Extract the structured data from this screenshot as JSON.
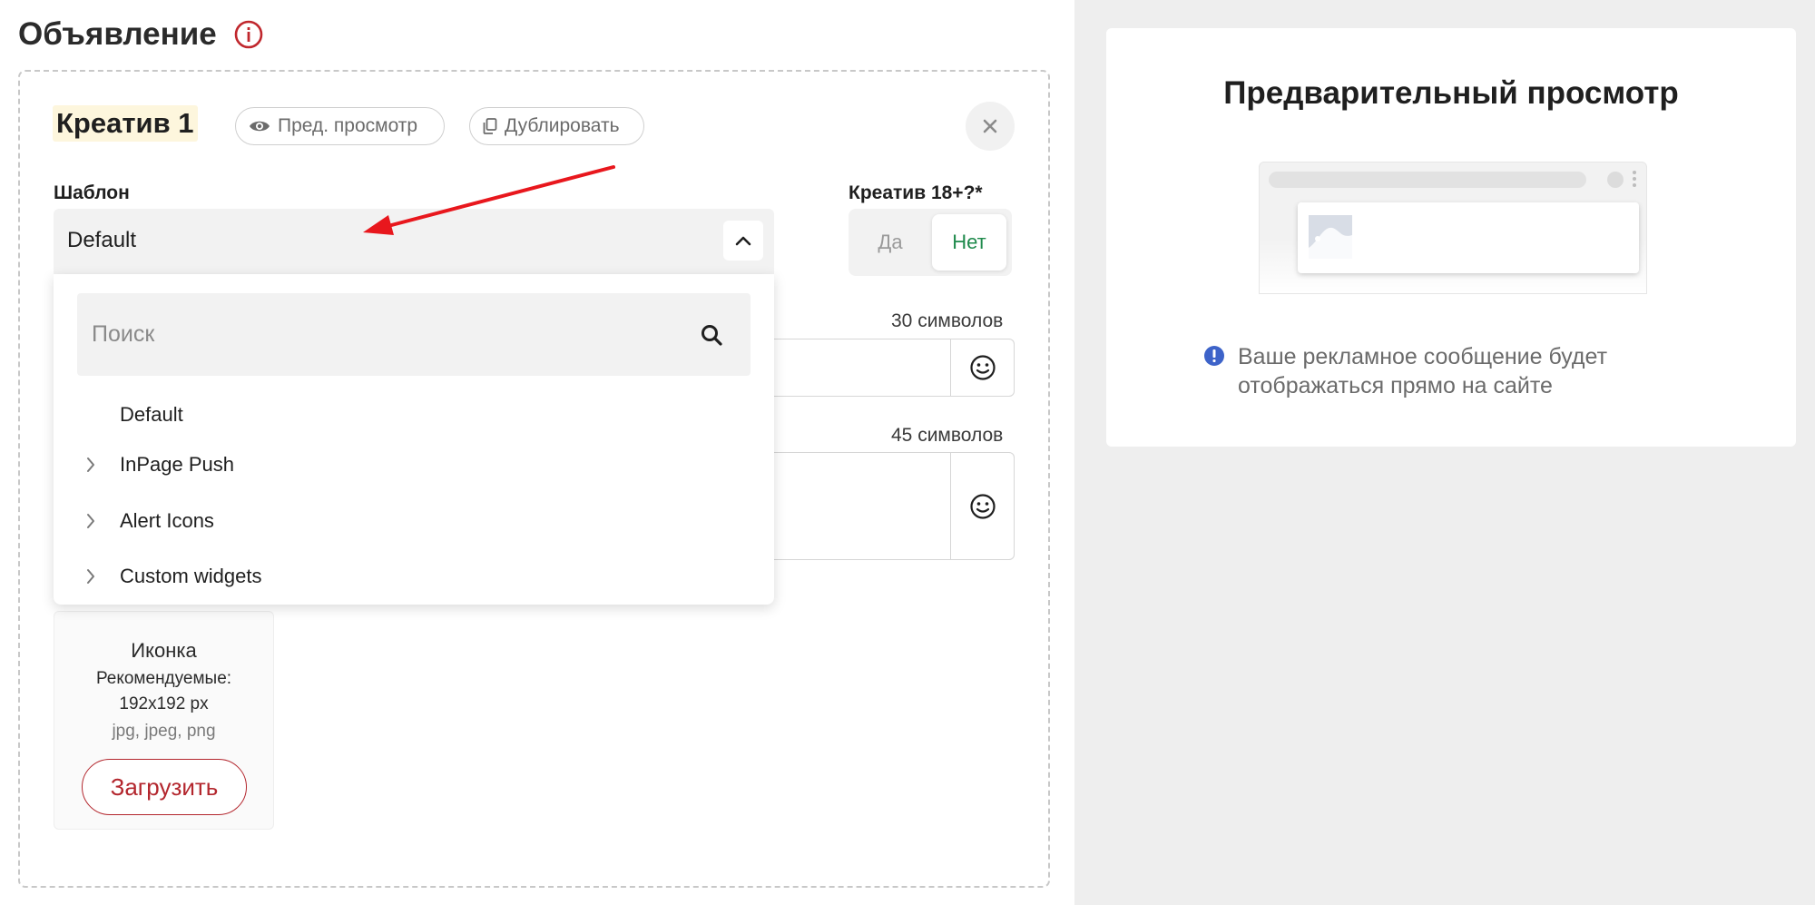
{
  "section": {
    "title": "Объявление"
  },
  "creative": {
    "title": "Креатив 1",
    "preview_label": "Пред. просмотр",
    "duplicate_label": "Дублировать"
  },
  "template": {
    "label": "Шаблон",
    "selected": "Default",
    "search_placeholder": "Поиск",
    "options": [
      "Default",
      "InPage Push",
      "Alert Icons",
      "Custom widgets"
    ]
  },
  "adult": {
    "label": "Креатив 18+?*",
    "yes": "Да",
    "no": "Нет",
    "selected": "Нет"
  },
  "fields": {
    "title_counter": "30 символов",
    "description_counter": "45 символов"
  },
  "icon_upload": {
    "title": "Иконка",
    "recommended": "Рекомендуемые:",
    "size": "192x192 px",
    "formats": "jpg, jpeg, png",
    "button": "Загрузить"
  },
  "preview": {
    "title": "Предварительный просмотр",
    "note": "Ваше рекламное сообщение будет отображаться прямо на сайте"
  },
  "colors": {
    "accent_red": "#b3262d",
    "toggle_green": "#1f8a4c",
    "info_blue": "#3d63c9",
    "arrow_red": "#e8171d"
  }
}
